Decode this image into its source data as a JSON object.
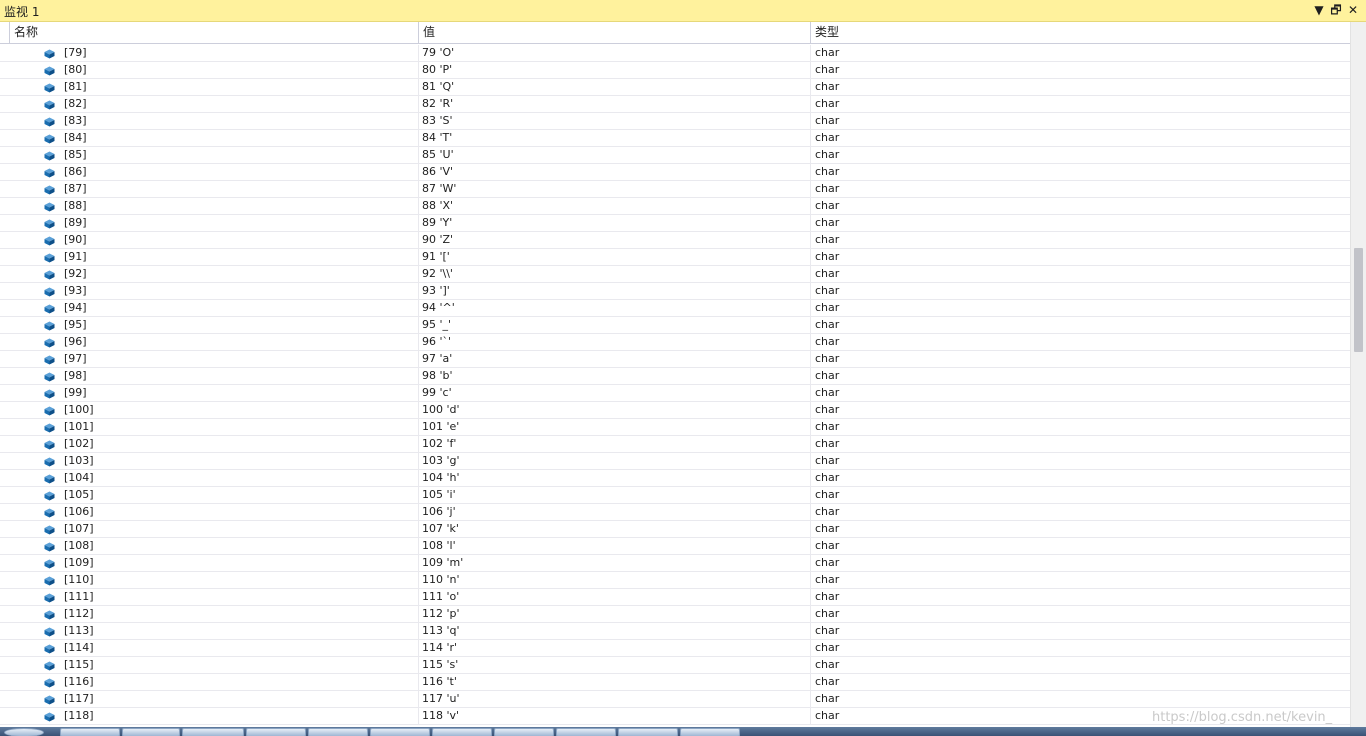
{
  "window": {
    "title": "监视 1",
    "buttons": {
      "dropdown": "▼",
      "restore": "🗗",
      "close": "✕"
    }
  },
  "columns": {
    "name": "名称",
    "value": "值",
    "type": "类型"
  },
  "rows": [
    {
      "name": "[79]",
      "value": "79 'O'",
      "type": "char"
    },
    {
      "name": "[80]",
      "value": "80 'P'",
      "type": "char"
    },
    {
      "name": "[81]",
      "value": "81 'Q'",
      "type": "char"
    },
    {
      "name": "[82]",
      "value": "82 'R'",
      "type": "char"
    },
    {
      "name": "[83]",
      "value": "83 'S'",
      "type": "char"
    },
    {
      "name": "[84]",
      "value": "84 'T'",
      "type": "char"
    },
    {
      "name": "[85]",
      "value": "85 'U'",
      "type": "char"
    },
    {
      "name": "[86]",
      "value": "86 'V'",
      "type": "char"
    },
    {
      "name": "[87]",
      "value": "87 'W'",
      "type": "char"
    },
    {
      "name": "[88]",
      "value": "88 'X'",
      "type": "char"
    },
    {
      "name": "[89]",
      "value": "89 'Y'",
      "type": "char"
    },
    {
      "name": "[90]",
      "value": "90 'Z'",
      "type": "char"
    },
    {
      "name": "[91]",
      "value": "91 '['",
      "type": "char"
    },
    {
      "name": "[92]",
      "value": "92 '\\\\'",
      "type": "char"
    },
    {
      "name": "[93]",
      "value": "93 ']'",
      "type": "char"
    },
    {
      "name": "[94]",
      "value": "94 '^'",
      "type": "char"
    },
    {
      "name": "[95]",
      "value": "95 '_'",
      "type": "char"
    },
    {
      "name": "[96]",
      "value": "96 '`'",
      "type": "char"
    },
    {
      "name": "[97]",
      "value": "97 'a'",
      "type": "char"
    },
    {
      "name": "[98]",
      "value": "98 'b'",
      "type": "char"
    },
    {
      "name": "[99]",
      "value": "99 'c'",
      "type": "char"
    },
    {
      "name": "[100]",
      "value": "100 'd'",
      "type": "char"
    },
    {
      "name": "[101]",
      "value": "101 'e'",
      "type": "char"
    },
    {
      "name": "[102]",
      "value": "102 'f'",
      "type": "char"
    },
    {
      "name": "[103]",
      "value": "103 'g'",
      "type": "char"
    },
    {
      "name": "[104]",
      "value": "104 'h'",
      "type": "char"
    },
    {
      "name": "[105]",
      "value": "105 'i'",
      "type": "char"
    },
    {
      "name": "[106]",
      "value": "106 'j'",
      "type": "char"
    },
    {
      "name": "[107]",
      "value": "107 'k'",
      "type": "char"
    },
    {
      "name": "[108]",
      "value": "108 'l'",
      "type": "char"
    },
    {
      "name": "[109]",
      "value": "109 'm'",
      "type": "char"
    },
    {
      "name": "[110]",
      "value": "110 'n'",
      "type": "char"
    },
    {
      "name": "[111]",
      "value": "111 'o'",
      "type": "char"
    },
    {
      "name": "[112]",
      "value": "112 'p'",
      "type": "char"
    },
    {
      "name": "[113]",
      "value": "113 'q'",
      "type": "char"
    },
    {
      "name": "[114]",
      "value": "114 'r'",
      "type": "char"
    },
    {
      "name": "[115]",
      "value": "115 's'",
      "type": "char"
    },
    {
      "name": "[116]",
      "value": "116 't'",
      "type": "char"
    },
    {
      "name": "[117]",
      "value": "117 'u'",
      "type": "char"
    },
    {
      "name": "[118]",
      "value": "118 'v'",
      "type": "char"
    }
  ],
  "icons": {
    "row_icon": "field-icon"
  },
  "colors": {
    "titlebar": "#fff29d",
    "icon": "#1a6eb0"
  },
  "watermark": "https://blog.csdn.net/kevin_"
}
